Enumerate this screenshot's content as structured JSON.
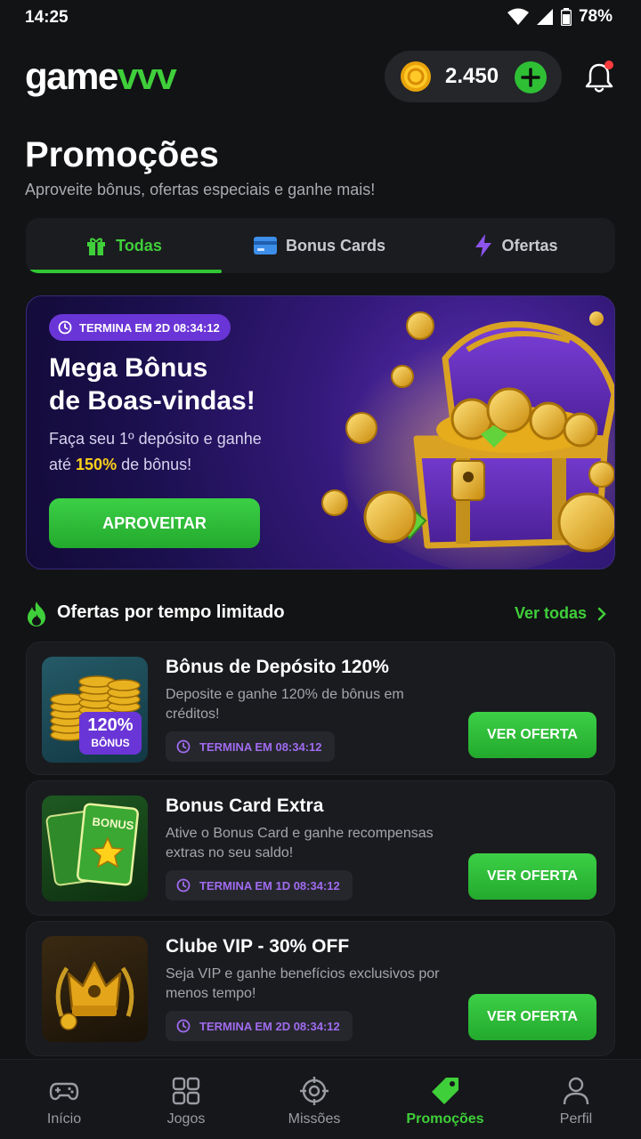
{
  "status": {
    "time": "14:25",
    "battery": "78%"
  },
  "header": {
    "logo_part1": "game",
    "logo_part2": "vvv",
    "coins": "2.450"
  },
  "page": {
    "title": "Promoções",
    "subtitle": "Aproveite bônus, ofertas especiais e ganhe mais!"
  },
  "tabs": [
    {
      "label": "Todas",
      "icon": "gift-icon",
      "active": true
    },
    {
      "label": "Bonus Cards",
      "icon": "card-icon",
      "active": false
    },
    {
      "label": "Ofertas",
      "icon": "lightning-icon",
      "active": false
    }
  ],
  "hero": {
    "badge": "TERMINA EM 2D 08:34:12",
    "title_line1": "Mega Bônus",
    "title_line2": "de Boas-vindas!",
    "desc_line1": "Faça seu 1º depósito e ganhe",
    "desc_pre": "até ",
    "desc_highlight": "150%",
    "desc_post": " de bônus!",
    "button": "APROVEITAR"
  },
  "section": {
    "title": "Ofertas por tempo limitado",
    "link": "Ver todas"
  },
  "offers": [
    {
      "title": "Bônus de Depósito 120%",
      "desc": "Deposite e ganhe 120% de bônus em créditos!",
      "timer": "TERMINA EM 08:34:12",
      "button": "VER OFERTA",
      "thumb_badge_top": "120%",
      "thumb_badge_bottom": "BÔNUS"
    },
    {
      "title": "Bonus Card Extra",
      "desc": "Ative o Bonus Card e ganhe recompensas extras no seu saldo!",
      "timer": "TERMINA EM 1D 08:34:12",
      "button": "VER OFERTA",
      "thumb_label": "BONUS"
    },
    {
      "title": "Clube VIP - 30% OFF",
      "desc": "Seja VIP e ganhe benefícios exclusivos por menos tempo!",
      "timer": "TERMINA EM 2D 08:34:12",
      "button": "VER OFERTA"
    }
  ],
  "nav": [
    {
      "label": "Início",
      "icon": "gamepad-icon"
    },
    {
      "label": "Jogos",
      "icon": "grid-icon"
    },
    {
      "label": "Missões",
      "icon": "target-icon"
    },
    {
      "label": "Promoções",
      "icon": "tag-icon",
      "active": true
    },
    {
      "label": "Perfil",
      "icon": "user-icon"
    }
  ],
  "colors": {
    "accent": "#3fcf3a",
    "background": "#121315",
    "purple": "#6a35d6",
    "gold": "#ffd11a"
  }
}
